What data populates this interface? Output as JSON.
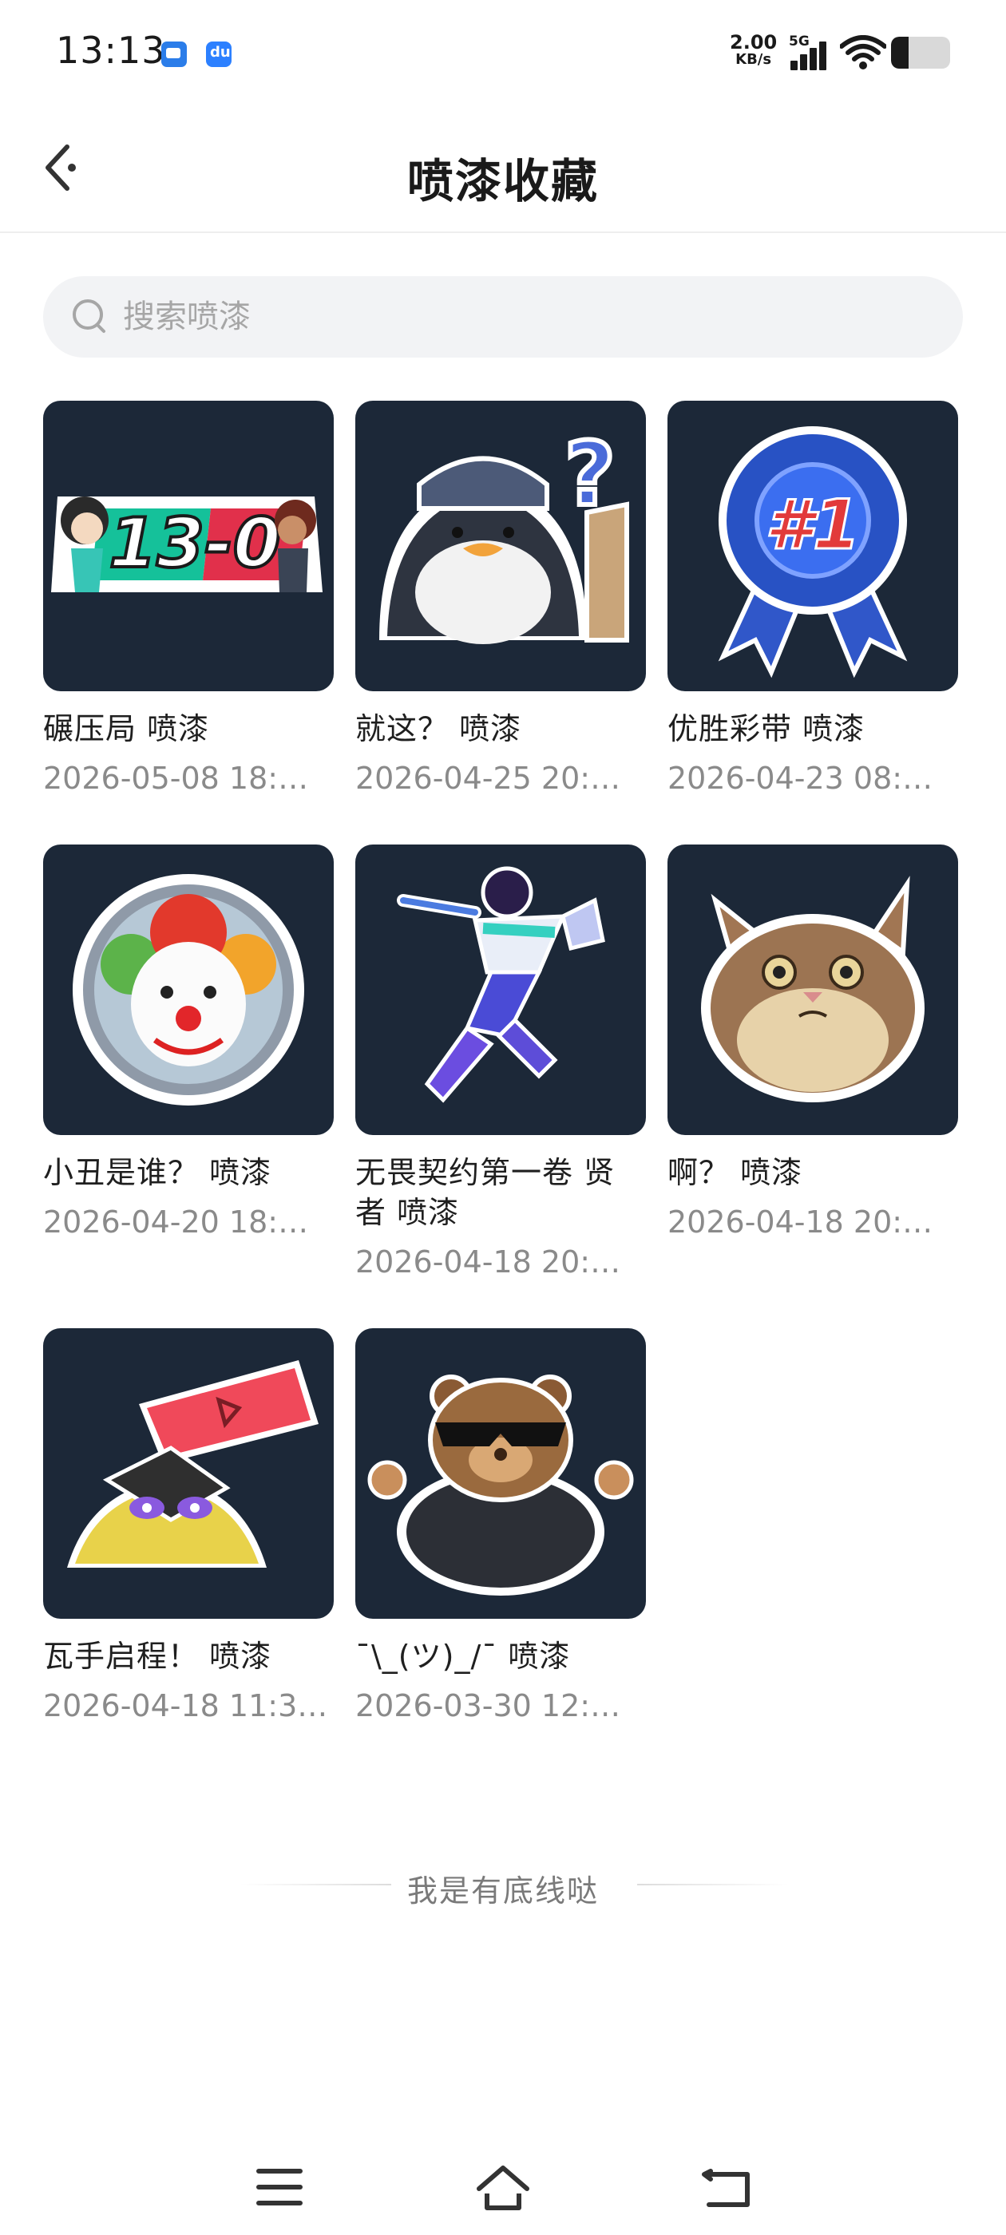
{
  "status_bar": {
    "time": "13:13",
    "net_speed_value": "2.00",
    "net_speed_unit": "KB/s",
    "network_type": "5G",
    "battery_level": 0.3,
    "notification_icons": [
      "chat-app-icon",
      "baidu-app-icon"
    ]
  },
  "header": {
    "title": "喷漆收藏",
    "back_icon": "chevron-left-icon"
  },
  "search": {
    "placeholder": "搜索喷漆",
    "value": "",
    "icon": "search-icon"
  },
  "items": [
    {
      "name": "碾压局 喷漆",
      "date": "2026-05-08 18:…",
      "image": "scoreboard-13-0-spray"
    },
    {
      "name": "就这？ 喷漆",
      "date": "2026-04-25 20:…",
      "image": "penguin-question-spray"
    },
    {
      "name": "优胜彩带 喷漆",
      "date": "2026-04-23 08:…",
      "image": "first-place-ribbon-spray"
    },
    {
      "name": "小丑是谁？ 喷漆",
      "date": "2026-04-20 18:…",
      "image": "clown-mirror-spray"
    },
    {
      "name": "无畏契约第一卷 贤者 喷漆",
      "date": "2026-04-18 20:…",
      "image": "sage-agent-spray"
    },
    {
      "name": "啊？ 喷漆",
      "date": "2026-04-18 20:…",
      "image": "confused-cat-spray"
    },
    {
      "name": "瓦手启程！ 喷漆",
      "date": "2026-04-18 11:3…",
      "image": "phone-creature-spray"
    },
    {
      "name": "¯\\_(ツ)_/¯ 喷漆",
      "date": "2026-03-30 12:…",
      "image": "shrug-bear-spray"
    }
  ],
  "footer": {
    "end_text": "我是有底线哒"
  },
  "nav_bar": {
    "buttons": [
      "menu-icon",
      "home-icon",
      "back-icon"
    ]
  },
  "colors": {
    "thumb_bg": "#1c2838",
    "search_bg": "#f2f3f5",
    "muted_text": "#8a8a8a"
  }
}
